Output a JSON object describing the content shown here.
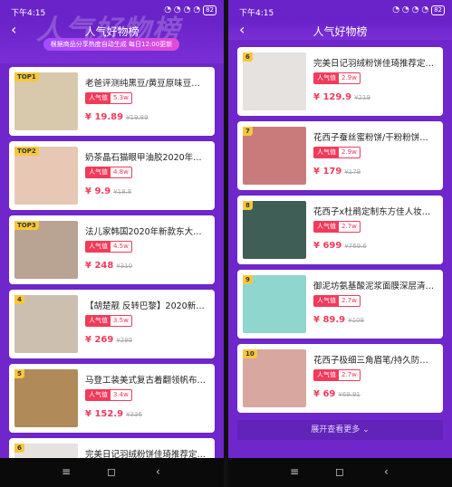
{
  "left": {
    "status_time": "下午4:15",
    "status_icons": "◔ ◔ ◔ ◔",
    "battery": "82",
    "title": "人气好物榜",
    "big_title": "人气好物榜",
    "banner": "根据商品分享热度自动生成  每日12:00更新",
    "cards": [
      {
        "rank": "TOP1",
        "title": "老爸评测纯黑豆/黄豆原味豆…",
        "pop_label": "人气值",
        "pop_value": "5.3w",
        "price": "¥ 19.89",
        "orig": "¥19.89",
        "color": "#d8c9ad"
      },
      {
        "rank": "TOP2",
        "title": "奶茶晶石猫眼甲油胶2020年…",
        "pop_label": "人气值",
        "pop_value": "4.8w",
        "price": "¥ 9.9",
        "orig": "¥18.8",
        "color": "#e7c8b5"
      },
      {
        "rank": "TOP3",
        "title": "法儿家韩国2020年新款东大…",
        "pop_label": "人气值",
        "pop_value": "4.5w",
        "price": "¥ 248",
        "orig": "¥310",
        "color": "#b9a392"
      },
      {
        "rank": "4",
        "title": "【胡楚靓 反转巴黎】2020新…",
        "pop_label": "人气值",
        "pop_value": "3.5w",
        "price": "¥ 269",
        "orig": "¥299",
        "color": "#cdbfb0"
      },
      {
        "rank": "5",
        "title": "马登工装美式复古着翻领帆布…",
        "pop_label": "人气值",
        "pop_value": "3.4w",
        "price": "¥ 152.9",
        "orig": "¥336",
        "color": "#b08a58"
      },
      {
        "rank": "6",
        "title": "完美日记羽绒粉饼佳琦推荐定…",
        "pop_label": "",
        "pop_value": "",
        "price": "",
        "orig": "",
        "color": "#e6e2df"
      }
    ]
  },
  "right": {
    "status_time": "下午4:15",
    "status_icons": "◔ ◔ ◔ ◔",
    "battery": "82",
    "title": "人气好物榜",
    "cards": [
      {
        "rank": "6",
        "title": "完美日记羽绒粉饼佳琦推荐定…",
        "pop_label": "人气值",
        "pop_value": "2.9w",
        "price": "¥ 129.9",
        "orig": "¥219",
        "color": "#e6e2df"
      },
      {
        "rank": "7",
        "title": "花西子蚕丝蜜粉饼/干粉粉饼…",
        "pop_label": "人气值",
        "pop_value": "2.9w",
        "price": "¥ 179",
        "orig": "¥179",
        "color": "#c97b7c"
      },
      {
        "rank": "8",
        "title": "花西子x杜鹃定制东方佳人妆…",
        "pop_label": "人气值",
        "pop_value": "2.7w",
        "price": "¥ 699",
        "orig": "¥769.6",
        "color": "#3f5e55"
      },
      {
        "rank": "9",
        "title": "御泥坊氨基酸泥浆面膜深层清…",
        "pop_label": "人气值",
        "pop_value": "2.7w",
        "price": "¥ 89.9",
        "orig": "¥109",
        "color": "#8fd6cf"
      },
      {
        "rank": "10",
        "title": "花西子极细三角眉笔/持久防…",
        "pop_label": "人气值",
        "pop_value": "2.7w",
        "price": "¥ 69",
        "orig": "¥69.91",
        "color": "#d8a7a0"
      }
    ],
    "more_label": "展开查看更多 ⌄"
  },
  "nav": {
    "menu": "≡",
    "home": "◻",
    "back": "‹"
  }
}
